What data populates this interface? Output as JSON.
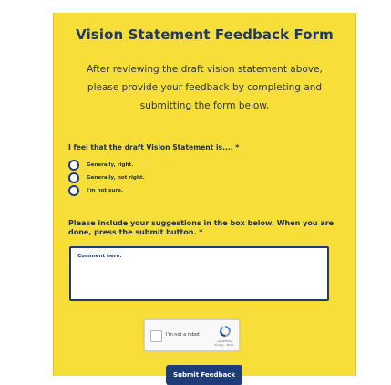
{
  "form": {
    "title": "Vision Statement Feedback Form",
    "intro": "After reviewing the draft vision statement above, please provide your feedback by completing and submitting the form below."
  },
  "question1": {
    "label": "I feel that the draft Vision Statement is.... *",
    "options": [
      {
        "label": "Generally, right."
      },
      {
        "label": "Generally, not right."
      },
      {
        "label": "I'm not sure."
      }
    ]
  },
  "question2": {
    "label": "Please include your suggestions in the box below. When you are done, press the submit button. *",
    "placeholder": "Comment here."
  },
  "captcha": {
    "label": "I'm not a robot",
    "brand": "reCAPTCHA",
    "links": "Privacy - Terms"
  },
  "submit_label": "Submit Feedback",
  "colors": {
    "background": "#f8de38",
    "accent": "#1f3c7a"
  }
}
